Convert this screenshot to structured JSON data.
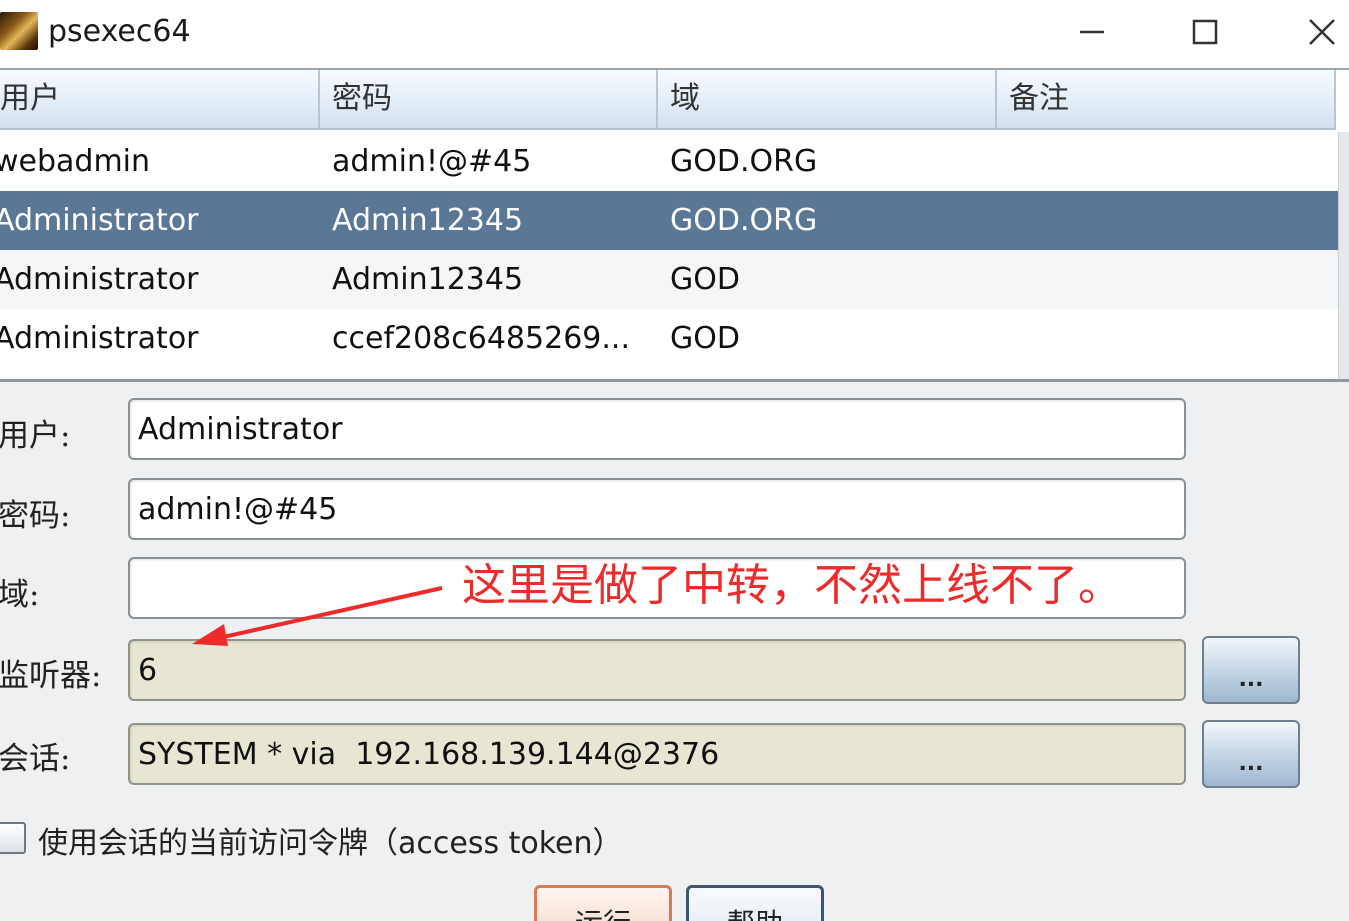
{
  "window": {
    "title": "psexec64",
    "app_icon": "app-icon",
    "minimize_icon": "minimize-icon",
    "maximize_icon": "maximize-icon",
    "close_icon": "close-icon"
  },
  "table": {
    "columns": [
      "用户",
      "密码",
      "域",
      "备注"
    ],
    "rows": [
      {
        "user": "webadmin",
        "password": "admin!@#45",
        "domain": "GOD.ORG",
        "note": "",
        "selected": false
      },
      {
        "user": "Administrator",
        "password": "Admin12345",
        "domain": "GOD.ORG",
        "note": "",
        "selected": true
      },
      {
        "user": "Administrator",
        "password": "Admin12345",
        "domain": "GOD",
        "note": "",
        "selected": false
      },
      {
        "user": "Administrator",
        "password": "ccef208c6485269...",
        "domain": "GOD",
        "note": "",
        "selected": false
      }
    ]
  },
  "form": {
    "user_label": "用户:",
    "user_value": "Administrator",
    "password_label": "密码:",
    "password_value": "admin!@#45",
    "domain_label": "域:",
    "domain_value": "",
    "listener_label": "监听器:",
    "listener_value": "6",
    "listener_browse": "...",
    "session_label": "会话:",
    "session_value": "SYSTEM * via  192.168.139.144@2376",
    "session_browse": "...",
    "token_checkbox_label": "使用会话的当前访问令牌（access token）",
    "token_checked": false
  },
  "buttons": {
    "run": "运行",
    "help": "帮助"
  },
  "annotation": {
    "text": "这里是做了中转，不然上线不了。",
    "color": "#ee2a2a"
  },
  "colors": {
    "selected_row": "#5a7796",
    "khaki_field": "#e6e6d2"
  }
}
